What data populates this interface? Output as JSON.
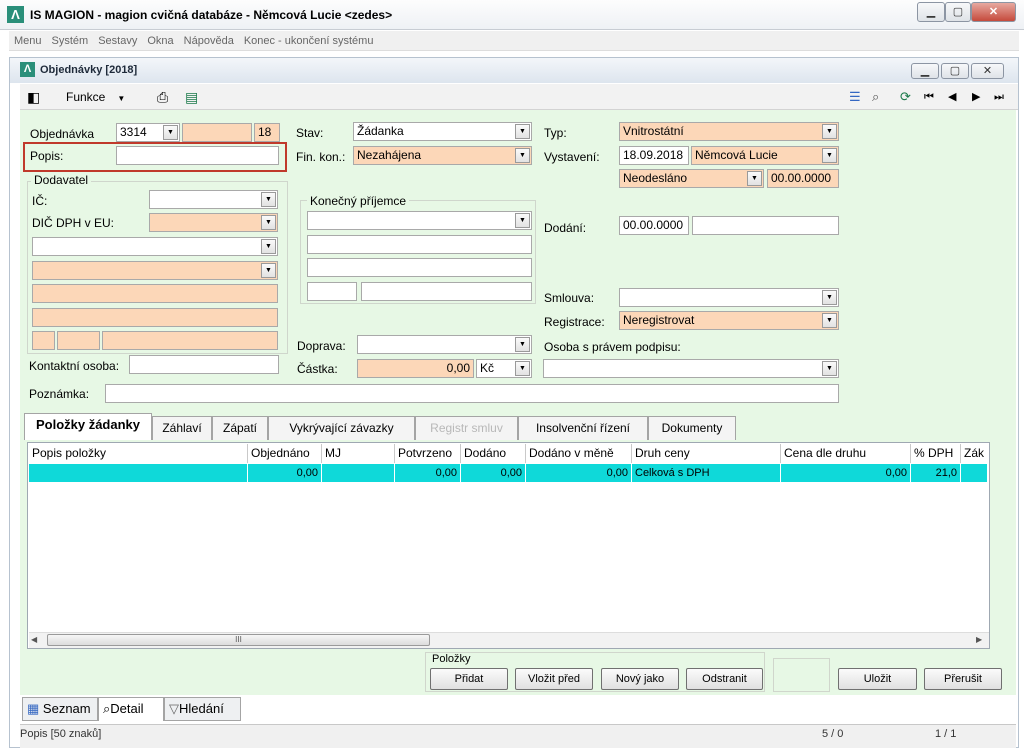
{
  "app": {
    "title": "IS MAGION - magion cvičná databáze - Němcová Lucie <zedes>",
    "logo": "logo-icon"
  },
  "menu": [
    "Menu",
    "Systém",
    "Sestavy",
    "Okna",
    "Nápověda",
    "Konec - ukončení systému"
  ],
  "child": {
    "title": "Objednávky [2018]"
  },
  "toolbar": {
    "funkce_label": "Funkce"
  },
  "form": {
    "objednavka_label": "Objednávka",
    "objednavka_value": "3314",
    "objednavka_num": "18",
    "popis_label": "Popis:",
    "popis_value": "",
    "dodavatel_label": "Dodavatel",
    "ic_label": "IČ:",
    "dic_label": "DIČ DPH v EU:",
    "kontakt_label": "Kontaktní osoba:",
    "stav_label": "Stav:",
    "stav_value": "Žádanka",
    "finkon_label": "Fin. kon.:",
    "finkon_value": "Nezahájena",
    "konecny_label": "Konečný příjemce",
    "doprava_label": "Doprava:",
    "castka_label": "Částka:",
    "castka_value": "0,00",
    "mena_value": "Kč",
    "typ_label": "Typ:",
    "typ_value": "Vnitrostátní",
    "vystaveni_label": "Vystavení:",
    "vystaveni_date": "18.09.2018",
    "vystaveni_user": "Němcová Lucie",
    "odeslano_value": "Neodesláno",
    "odeslano_date": "00.00.0000",
    "dodani_label": "Dodání:",
    "dodani_date": "00.00.0000",
    "smlouva_label": "Smlouva:",
    "registrace_label": "Registrace:",
    "registrace_value": "Neregistrovat",
    "osoba_label": "Osoba s právem podpisu:",
    "poznamka_label": "Poznámka:"
  },
  "tabs": [
    "Položky žádanky",
    "Záhlaví",
    "Zápatí",
    "Vykrývající závazky",
    "Registr smluv",
    "Insolvenční řízení",
    "Dokumenty"
  ],
  "grid": {
    "headers": [
      "Popis položky",
      "Objednáno",
      "MJ",
      "Potvrzeno",
      "Dodáno",
      "Dodáno v měně",
      "Druh ceny",
      "Cena dle druhu",
      "% DPH",
      "Zák"
    ],
    "row": [
      "",
      "0,00",
      "",
      "0,00",
      "0,00",
      "0,00",
      "Celková s DPH",
      "0,00",
      "21,0",
      ""
    ],
    "scroll_glyph": "III"
  },
  "polozky": {
    "label": "Položky",
    "pridat": "Přidat",
    "vlozit": "Vložit před",
    "novy": "Nový jako",
    "odstranit": "Odstranit"
  },
  "actions": {
    "ulozit": "Uložit",
    "prerusit": "Přerušit"
  },
  "views": [
    "Seznam",
    "Detail",
    "Hledání"
  ],
  "status": {
    "left": "Popis [50 znaků]",
    "mid": "5 / 0",
    "right": "1 / 1"
  },
  "colors": {
    "highlight": "#0fd9d9",
    "required": "#fcd7b8",
    "panel": "#e7f8e5",
    "callout": "#c0392b"
  }
}
